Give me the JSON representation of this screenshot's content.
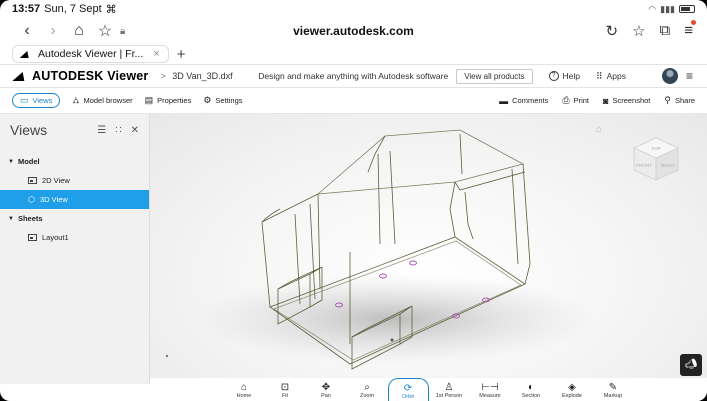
{
  "status": {
    "time": "13:57",
    "date": "Sun, 7 Sept",
    "indicator": "⌘"
  },
  "browser": {
    "url": "viewer.autodesk.com",
    "tab_title": "Autodesk Viewer | Fr...",
    "tab_close": "×",
    "tab_add": "+"
  },
  "header": {
    "app_name": "AUTODESK Viewer",
    "breadcrumb_sep": ">",
    "file_name": "3D Van_3D.dxf",
    "tagline": "Design and make anything with Autodesk software",
    "view_products": "View all products",
    "help": "Help",
    "apps": "Apps"
  },
  "toolbar": {
    "left": [
      {
        "label": "Views",
        "icon": "views-icon",
        "active": true
      },
      {
        "label": "Model browser",
        "icon": "model-browser-icon"
      },
      {
        "label": "Properties",
        "icon": "properties-icon"
      },
      {
        "label": "Settings",
        "icon": "gear-icon"
      }
    ],
    "right": [
      {
        "label": "Comments",
        "icon": "comment-icon"
      },
      {
        "label": "Print",
        "icon": "printer-icon"
      },
      {
        "label": "Screenshot",
        "icon": "camera-icon"
      },
      {
        "label": "Share",
        "icon": "link-icon"
      }
    ]
  },
  "panel": {
    "title": "Views",
    "groups": [
      {
        "label": "Model",
        "items": [
          {
            "label": "2D View",
            "selected": false
          },
          {
            "label": "3D View",
            "selected": true
          }
        ]
      },
      {
        "label": "Sheets",
        "items": [
          {
            "label": "Layout1",
            "selected": false
          }
        ]
      }
    ]
  },
  "viewcube": {
    "front": "FRONT",
    "right": "RIGHT",
    "top": "TOP"
  },
  "bottom_tools": [
    {
      "label": "Home",
      "glyph": "⌂"
    },
    {
      "label": "Fit",
      "glyph": "⊡"
    },
    {
      "label": "Pan",
      "glyph": "✥"
    },
    {
      "label": "Zoom",
      "glyph": "⌕"
    },
    {
      "label": "Orbit",
      "glyph": "⟳",
      "active": true
    },
    {
      "label": "1st Person",
      "glyph": "♙"
    },
    {
      "label": "Measure",
      "glyph": "⊢⊣"
    },
    {
      "label": "Section",
      "glyph": "◐"
    },
    {
      "label": "Explode",
      "glyph": "◈"
    },
    {
      "label": "Markup",
      "glyph": "✎"
    }
  ],
  "colors": {
    "accent": "#1e9fe8",
    "wire": "#5b5f3a",
    "marker": "#b050b8"
  }
}
